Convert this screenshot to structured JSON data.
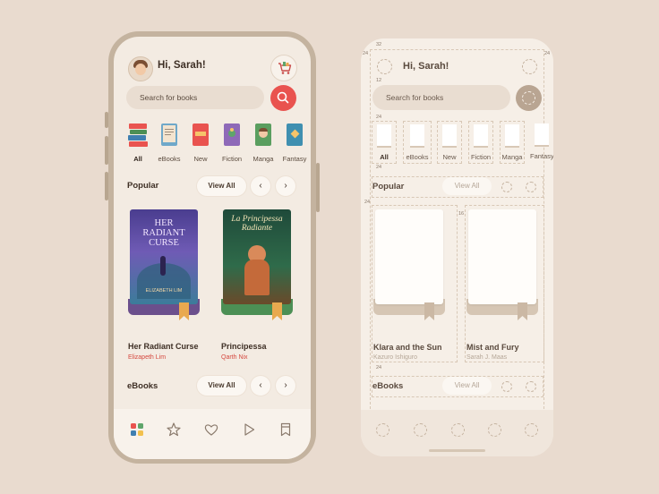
{
  "user": {
    "greeting": "Hi, Sarah!"
  },
  "search": {
    "placeholder": "Search for books"
  },
  "categories": [
    {
      "label": "All",
      "active": true
    },
    {
      "label": "eBooks",
      "active": false
    },
    {
      "label": "New",
      "active": false
    },
    {
      "label": "Fiction",
      "active": false
    },
    {
      "label": "Manga",
      "active": false
    },
    {
      "label": "Fantasy",
      "active": false
    }
  ],
  "sections": {
    "popular": {
      "title": "Popular",
      "view_all": "View All"
    },
    "ebooks": {
      "title": "eBooks",
      "view_all": "View All"
    }
  },
  "books": [
    {
      "title": "Her Radiant Curse",
      "author": "Elizapeth Lim",
      "cover_title": "HER RADIANT CURSE",
      "cover_author": "ELIZABETH LIM",
      "color": "#6b4f8c"
    },
    {
      "title": "Principessa",
      "author": "Qarth Nix",
      "cover_title": "La Principessa Radiante",
      "color": "#4c8f55"
    }
  ],
  "nav": [
    "grid-icon",
    "star-icon",
    "heart-icon",
    "play-icon",
    "bookmark-icon"
  ],
  "wireframe": {
    "greeting": "Hi, Sarah!",
    "search_placeholder": "Search for books",
    "categories": [
      "All",
      "eBooks",
      "New",
      "Fiction",
      "Manga",
      "Fantasy"
    ],
    "popular_title": "Popular",
    "ebooks_title": "eBooks",
    "view_all": "View All",
    "books": [
      {
        "title": "Klara and the Sun",
        "author": "Kazuro Ishiguro"
      },
      {
        "title": "Mist and Fury",
        "author": "Sarah J. Maas"
      }
    ],
    "spacing": {
      "top": "32",
      "side": "24",
      "gap": "12",
      "book_gap": "16"
    }
  },
  "colors": {
    "accent": "#e9534f",
    "background": "#e9dbcf",
    "screen": "#f3ebe2"
  }
}
